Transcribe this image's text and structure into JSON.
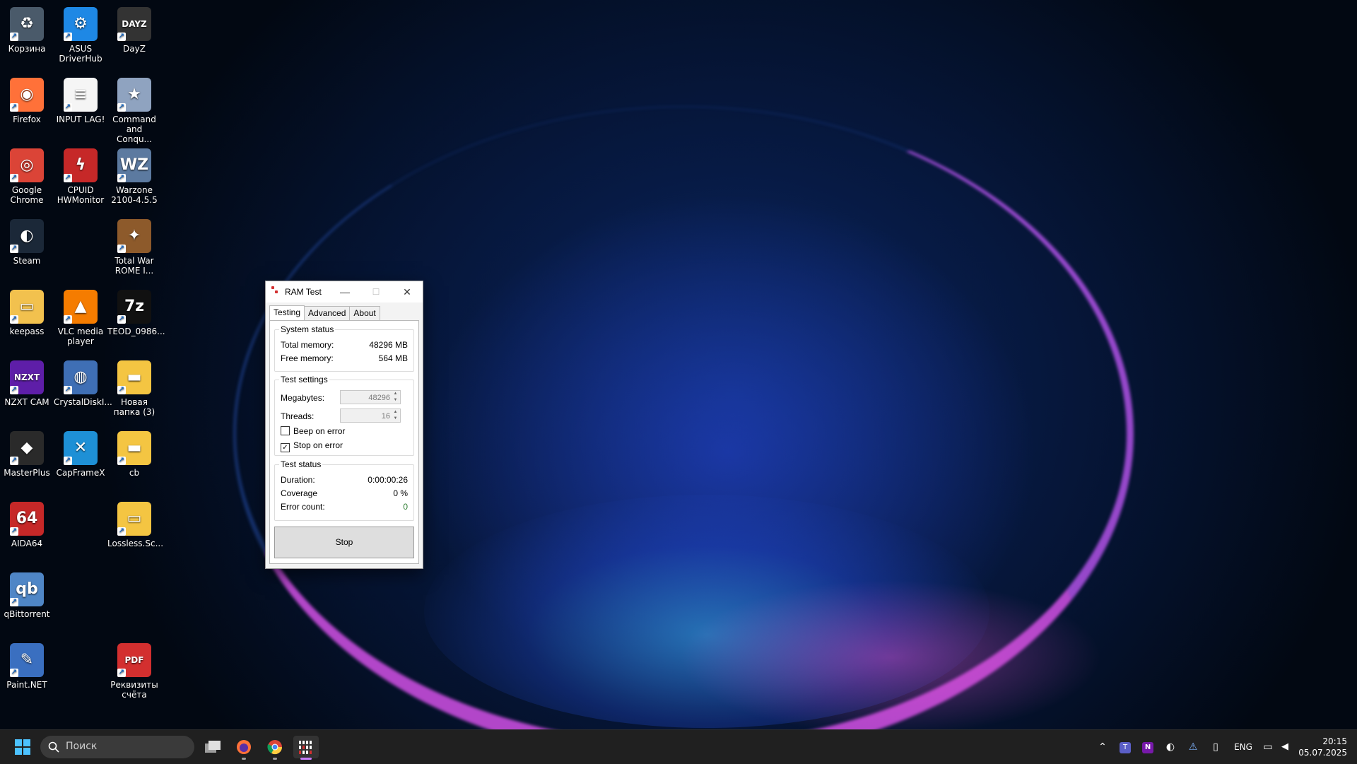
{
  "desktop": {
    "icons": [
      {
        "label": "Корзина",
        "color": "#4a5a6a",
        "glyph": "♻"
      },
      {
        "label": "ASUS DriverHub",
        "color": "#1e88e5",
        "glyph": "⚙"
      },
      {
        "label": "DayZ",
        "color": "#333333",
        "glyph": "DAYZ"
      },
      {
        "label": "Firefox",
        "color": "#ff7139",
        "glyph": "◉"
      },
      {
        "label": "INPUT LAG!",
        "color": "#f5f5f5",
        "glyph": "≡"
      },
      {
        "label": "Command and Conqu...",
        "color": "#8fa3c0",
        "glyph": "★"
      },
      {
        "label": "Google Chrome",
        "color": "#db4437",
        "glyph": "◎"
      },
      {
        "label": "CPUID HWMonitor",
        "color": "#c62828",
        "glyph": "ϟ"
      },
      {
        "label": "Warzone 2100-4.5.5",
        "color": "#5c7aa0",
        "glyph": "WZ"
      },
      {
        "label": "Steam",
        "color": "#1b2838",
        "glyph": "◐"
      },
      {
        "label": "Total War ROME I...",
        "color": "#8d5a2b",
        "glyph": "✦"
      },
      {
        "label": "keepass",
        "color": "#f2c14e",
        "glyph": "▭"
      },
      {
        "label": "VLC media player",
        "color": "#f57c00",
        "glyph": "▲"
      },
      {
        "label": "TEOD_0986...",
        "color": "#111111",
        "glyph": "7z"
      },
      {
        "label": "NZXT CAM",
        "color": "#5e1ea8",
        "glyph": "NZXT"
      },
      {
        "label": "CrystalDiskI...",
        "color": "#3f6fb5",
        "glyph": "◍"
      },
      {
        "label": "Новая папка (3)",
        "color": "#f4c542",
        "glyph": "▬"
      },
      {
        "label": "MasterPlus",
        "color": "#2a2a2a",
        "glyph": "◆"
      },
      {
        "label": "CapFrameX",
        "color": "#1e90d6",
        "glyph": "✕"
      },
      {
        "label": "cb",
        "color": "#f4c542",
        "glyph": "▬"
      },
      {
        "label": "AIDA64",
        "color": "#c62828",
        "glyph": "64"
      },
      {
        "label": "Lossless.Sc...",
        "color": "#f4c542",
        "glyph": "▭"
      },
      {
        "label": "qBittorrent",
        "color": "#4f86c6",
        "glyph": "qb"
      },
      {
        "label": "Paint.NET",
        "color": "#3a6fc0",
        "glyph": "✎"
      },
      {
        "label": "Реквизиты счёта",
        "color": "#d32f2f",
        "glyph": "PDF"
      }
    ]
  },
  "window": {
    "title": "RAM Test",
    "minimize": "—",
    "maximize": "☐",
    "close": "✕",
    "tabs": [
      "Testing",
      "Advanced",
      "About"
    ],
    "system_status": {
      "label": "System status",
      "total_memory_label": "Total memory:",
      "total_memory_value": "48296 MB",
      "free_memory_label": "Free memory:",
      "free_memory_value": "564 MB"
    },
    "test_settings": {
      "label": "Test settings",
      "megabytes_label": "Megabytes:",
      "megabytes_value": "48296",
      "threads_label": "Threads:",
      "threads_value": "16",
      "beep_label": "Beep on error",
      "beep_checked": false,
      "stop_label": "Stop on error",
      "stop_checked": true
    },
    "test_status": {
      "label": "Test status",
      "duration_label": "Duration:",
      "duration_value": "0:00:00:26",
      "coverage_label": "Coverage",
      "coverage_value": "0 %",
      "error_label": "Error count:",
      "error_value": "0",
      "error_color": "#2e7d32"
    },
    "stop_button": "Stop"
  },
  "taskbar": {
    "search_placeholder": "Поиск",
    "language": "ENG",
    "time": "20:15",
    "date": "05.07.2025"
  }
}
